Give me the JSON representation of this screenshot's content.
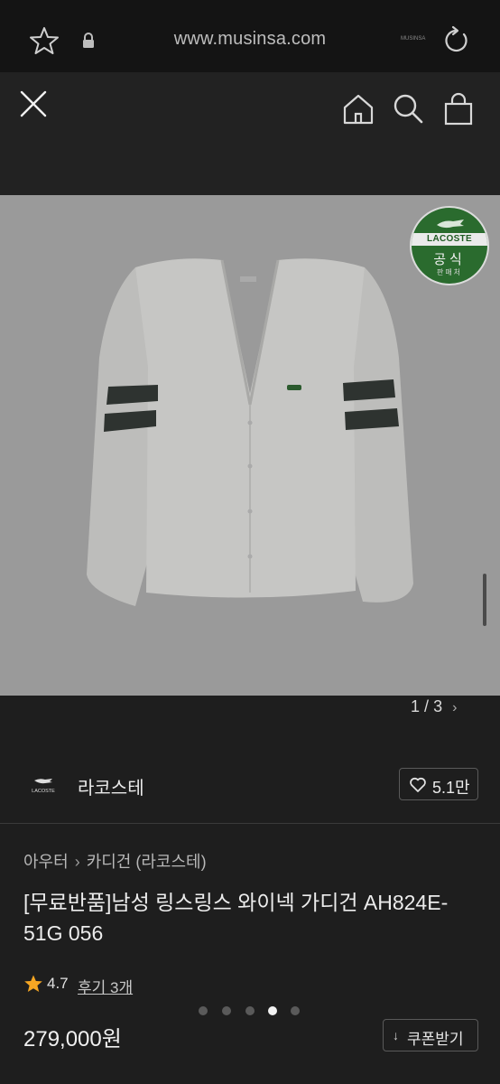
{
  "browser": {
    "url": "www.musinsa.com",
    "mini_text": "MUSINSA"
  },
  "icons": {
    "favorite": "star-outline-icon",
    "secure": "lock-icon",
    "reload": "reload-icon",
    "close": "close-icon",
    "home": "home-icon",
    "search": "search-icon",
    "cart": "shopping-bag-icon"
  },
  "badge": {
    "brand": "LACOSTE",
    "main": "공식",
    "sub": "판매처"
  },
  "gallery": {
    "current": "1",
    "separator": "/",
    "total": "3",
    "next_glyph": "›"
  },
  "brand_row": {
    "logo_text": "LACOSTE",
    "name": "라코스테",
    "likes": "5.1만"
  },
  "product": {
    "breadcrumb": [
      "아우터",
      "카디건 (라코스테)"
    ],
    "breadcrumb_sep": "›",
    "title": "[무료반품]남성 링스링스 와이넥 가디건 AH824E-51G 056",
    "rating": "4.7",
    "reviews": "후기 3개",
    "price": "279,000원",
    "coupon_label": "쿠폰받기",
    "coupon_glyph": "↓"
  },
  "carousel": {
    "count": 5,
    "active_index": 3
  },
  "colors": {
    "background": "#1e1e1e",
    "badge_green": "#2a6b2e",
    "star": "#f5a623"
  }
}
